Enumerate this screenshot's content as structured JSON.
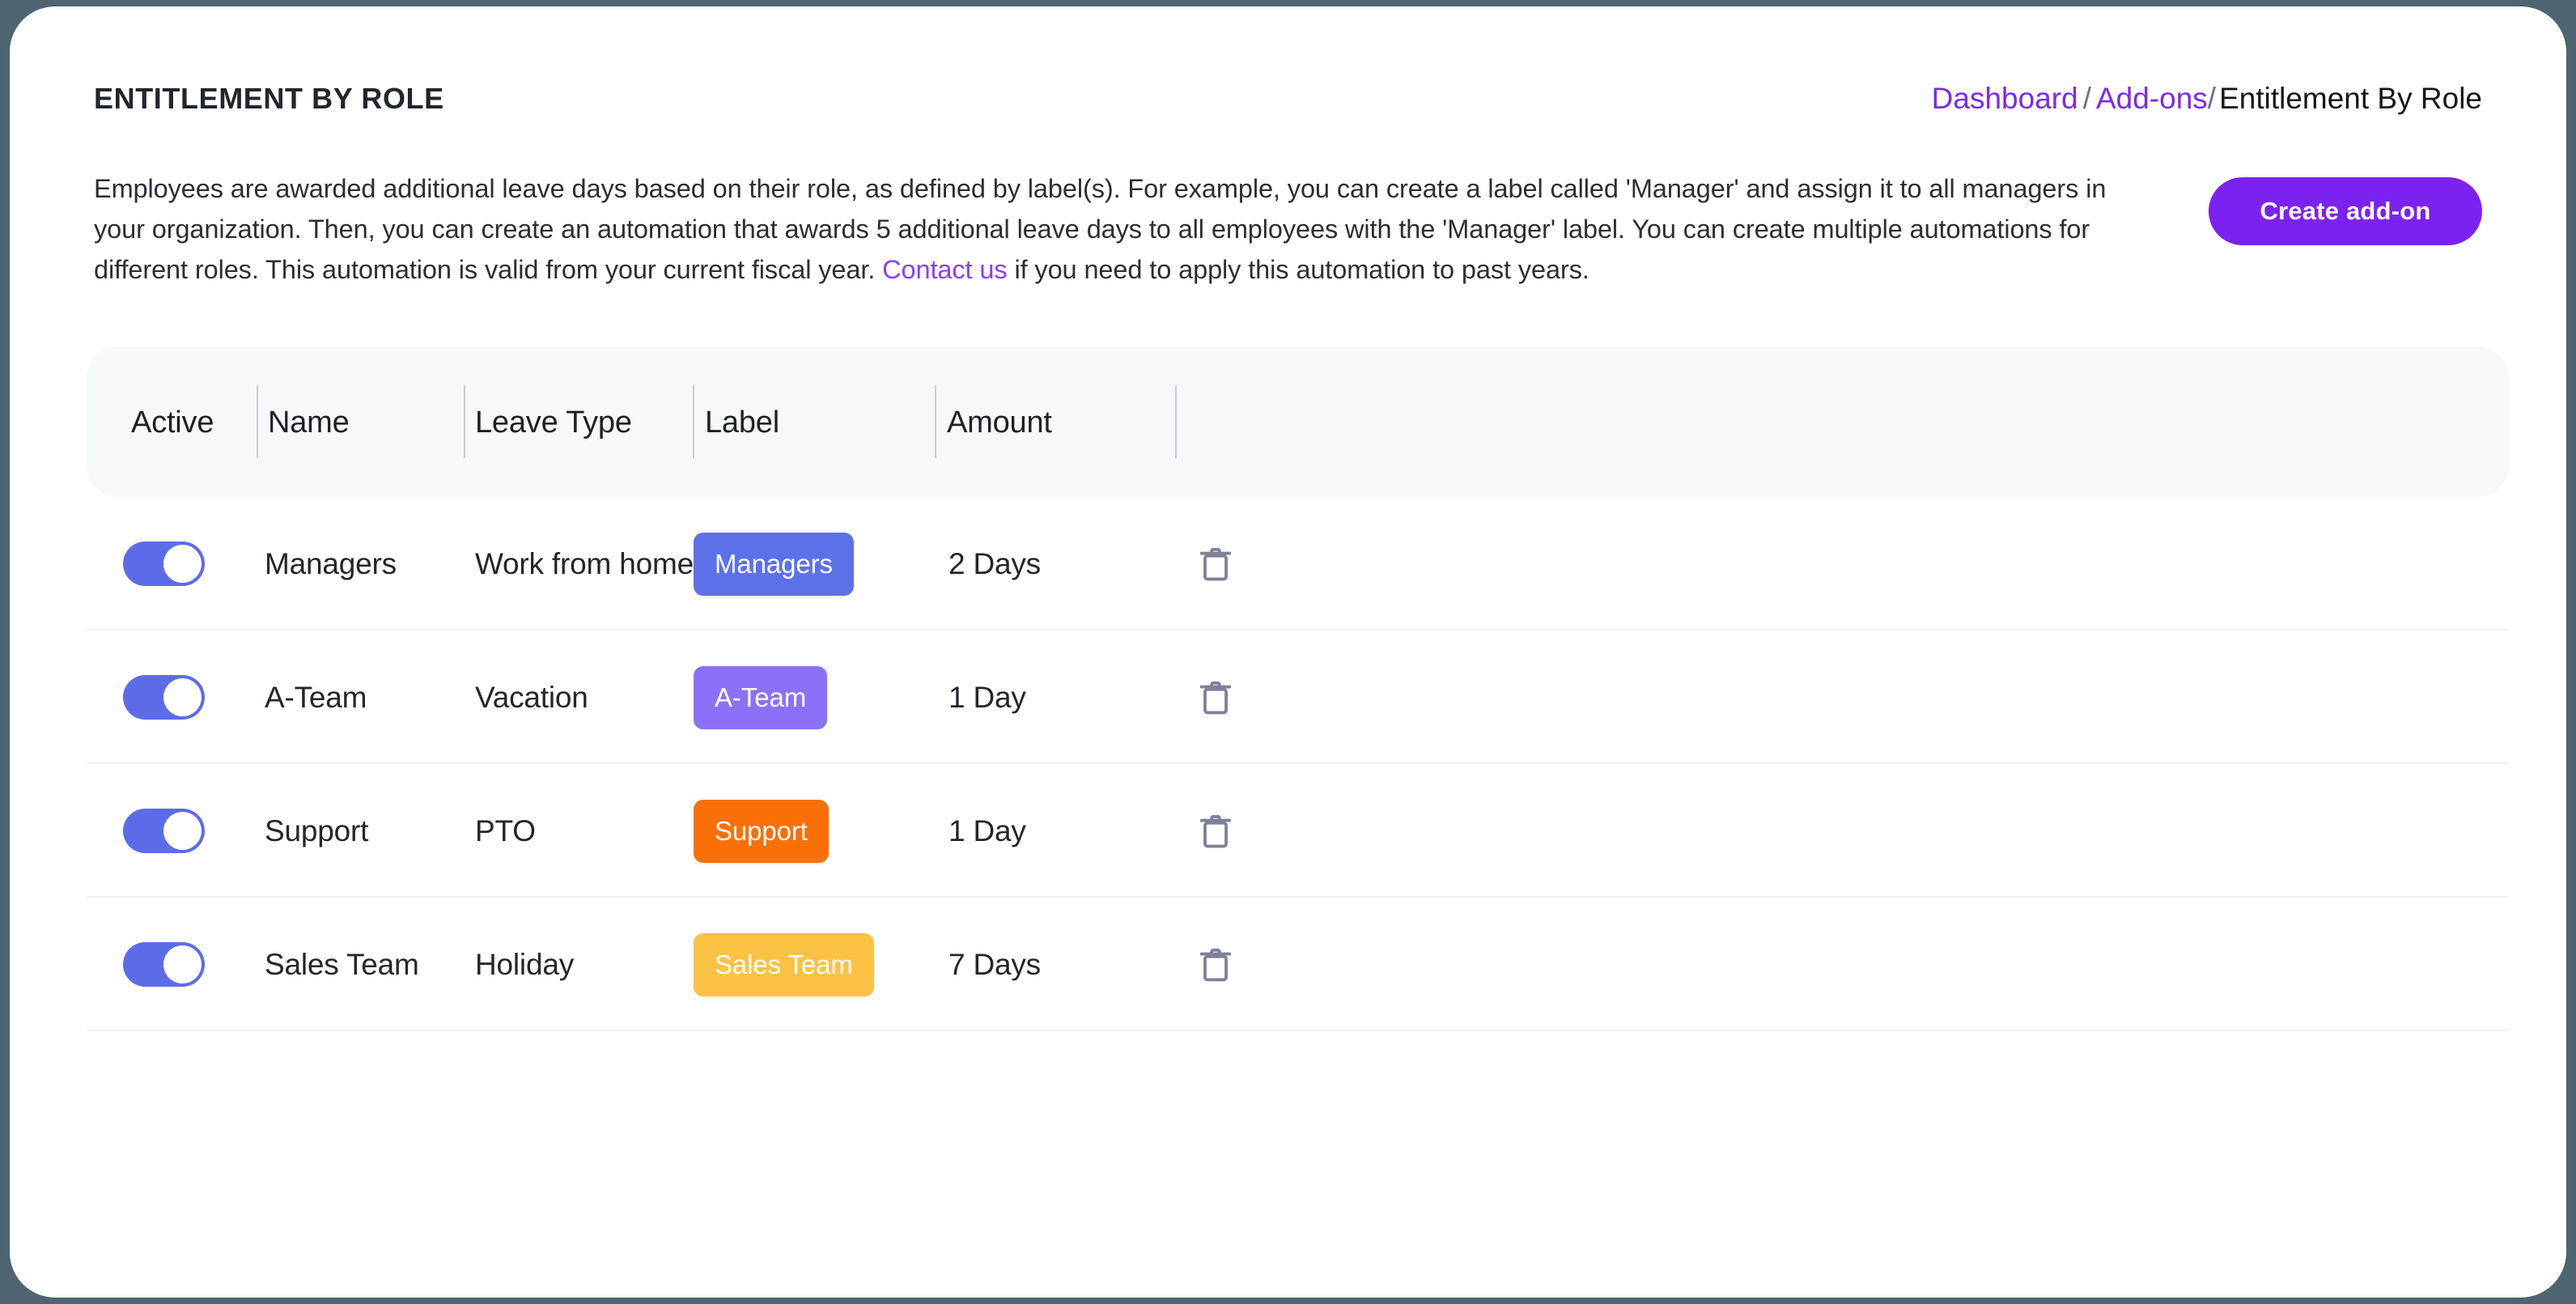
{
  "page": {
    "title": "ENTITLEMENT BY ROLE"
  },
  "breadcrumb": {
    "dashboard": "Dashboard",
    "separator1": "/",
    "addons": "Add-ons",
    "separator2": "/",
    "current": "Entitlement By Role"
  },
  "description": {
    "part1": "Employees are awarded additional leave days based on their role, as defined by label(s). For example, you can create a label called 'Manager' and assign it to all managers in your organization. Then, you can create an automation that awards 5 additional leave days to all employees with the 'Manager' label. You can create multiple automations for different roles. This automation is valid from your current fiscal year. ",
    "contact_link": "Contact us",
    "part2": " if you need to apply this automation to past years."
  },
  "toolbar": {
    "create_label": "Create add-on"
  },
  "table": {
    "columns": [
      {
        "key": "active",
        "label": "Active"
      },
      {
        "key": "name",
        "label": "Name"
      },
      {
        "key": "leave_type",
        "label": "Leave Type"
      },
      {
        "key": "label",
        "label": "Label"
      },
      {
        "key": "amount",
        "label": "Amount"
      },
      {
        "key": "actions",
        "label": ""
      }
    ],
    "rows": [
      {
        "active": true,
        "name": "Managers",
        "leave_type": "Work from home",
        "label": "Managers",
        "label_color": "#5c71e8",
        "amount": "2 Days",
        "delete_icon": "trash-icon"
      },
      {
        "active": true,
        "name": "A-Team",
        "leave_type": "Vacation",
        "label": "A-Team",
        "label_color": "#8b71f7",
        "amount": "1 Day",
        "delete_icon": "trash-icon"
      },
      {
        "active": true,
        "name": "Support",
        "leave_type": "PTO",
        "label": "Support",
        "label_color": "#fa7008",
        "amount": "1 Day",
        "delete_icon": "trash-icon"
      },
      {
        "active": true,
        "name": "Sales Team",
        "leave_type": "Holiday",
        "label": "Sales Team",
        "label_color": "#fbc244",
        "amount": "7 Days",
        "delete_icon": "trash-icon"
      }
    ]
  },
  "colors": {
    "brand_purple": "#7c22f0",
    "link_purple": "#7c2ae8",
    "toggle_on": "#5c6ce8",
    "page_backdrop": "#4f6471",
    "header_row_bg": "#f7f8f9",
    "trash_gray": "#7e8196"
  }
}
